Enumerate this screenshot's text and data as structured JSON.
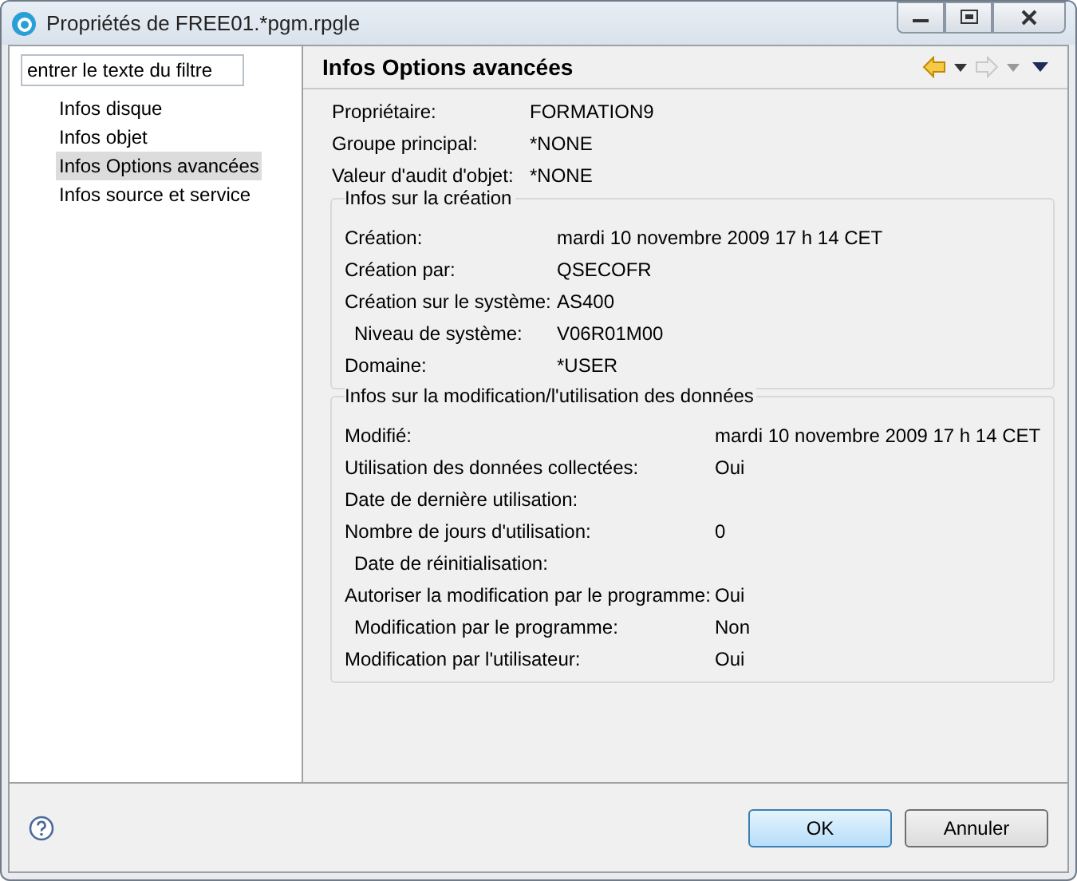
{
  "window": {
    "title": "Propriétés de FREE01.*pgm.rpgle"
  },
  "sidebar": {
    "filter": {
      "placeholder": "entrer le texte du filtre"
    },
    "items": [
      {
        "label": "Infos disque",
        "selected": false
      },
      {
        "label": "Infos objet",
        "selected": false
      },
      {
        "label": "Infos Options avancées",
        "selected": true
      },
      {
        "label": "Infos source et service",
        "selected": false
      }
    ]
  },
  "page": {
    "title": "Infos Options avancées",
    "fields": [
      {
        "label": "Propriétaire:",
        "value": "FORMATION9"
      },
      {
        "label": "Groupe principal:",
        "value": "*NONE"
      },
      {
        "label": "Valeur d'audit d'objet:",
        "value": "*NONE"
      }
    ],
    "groups": [
      {
        "title": "Infos sur la création",
        "rows": [
          {
            "label": "Création:",
            "value": "mardi 10 novembre 2009 17 h 14 CET",
            "indented": false
          },
          {
            "label": "Création par:",
            "value": "QSECOFR",
            "indented": false
          },
          {
            "label": "Création sur le système:",
            "value": "AS400",
            "indented": false
          },
          {
            "label": "Niveau de système:",
            "value": "V06R01M00",
            "indented": true
          },
          {
            "label": "Domaine:",
            "value": "*USER",
            "indented": false
          }
        ]
      },
      {
        "title": "Infos sur la modification/l'utilisation des données",
        "rows": [
          {
            "label": "Modifié:",
            "value": "mardi 10 novembre 2009 17 h 14 CET",
            "indented": false
          },
          {
            "label": "Utilisation des données collectées:",
            "value": "Oui",
            "indented": false
          },
          {
            "label": "Date de dernière utilisation:",
            "indented": false
          },
          {
            "label": "Nombre de jours d'utilisation:",
            "value": "0",
            "indented": false
          },
          {
            "label": "Date de réinitialisation:",
            "indented": true
          },
          {
            "label": "Autoriser la modification par le programme:",
            "value": "Oui",
            "indented": false
          },
          {
            "label": "Modification par le programme:",
            "value": "Non",
            "indented": true
          },
          {
            "label": "Modification par l'utilisateur:",
            "value": "Oui",
            "indented": false
          }
        ]
      }
    ]
  },
  "buttons": [
    {
      "label": "OK",
      "kind": "default"
    },
    {
      "label": "Annuler",
      "kind": "normal"
    }
  ]
}
